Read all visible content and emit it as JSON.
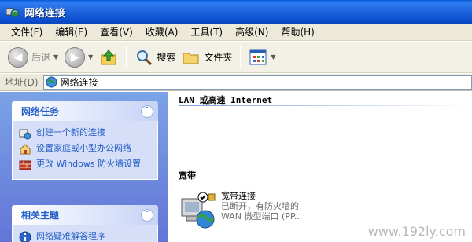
{
  "window": {
    "title": "网络连接"
  },
  "menu": [
    "文件(F)",
    "编辑(E)",
    "查看(V)",
    "收藏(A)",
    "工具(T)",
    "高级(N)",
    "帮助(H)"
  ],
  "toolbar": {
    "back_label": "后退",
    "search_label": "搜索",
    "folders_label": "文件夹"
  },
  "address": {
    "label": "地址(D)",
    "value": "网络连接"
  },
  "network_tasks": {
    "title": "网络任务",
    "items": [
      "创建一个新的连接",
      "设置家庭或小型办公网络",
      "更改 Windows 防火墙设置"
    ]
  },
  "related_topics": {
    "title": "相关主题",
    "items": [
      "网络疑难解答程序"
    ]
  },
  "content": {
    "group_lan": "LAN 或高速 Internet",
    "group_broadband": "宽带",
    "connection": {
      "name": "宽带连接",
      "status": "已断开，有防火墙的",
      "device": "WAN 微型端口 (PP..."
    }
  },
  "watermark": "www.192ly.com",
  "colors": {
    "titlebar": "#0b4fd0",
    "taskpane": "#7ba2e7",
    "link": "#215dc6"
  }
}
